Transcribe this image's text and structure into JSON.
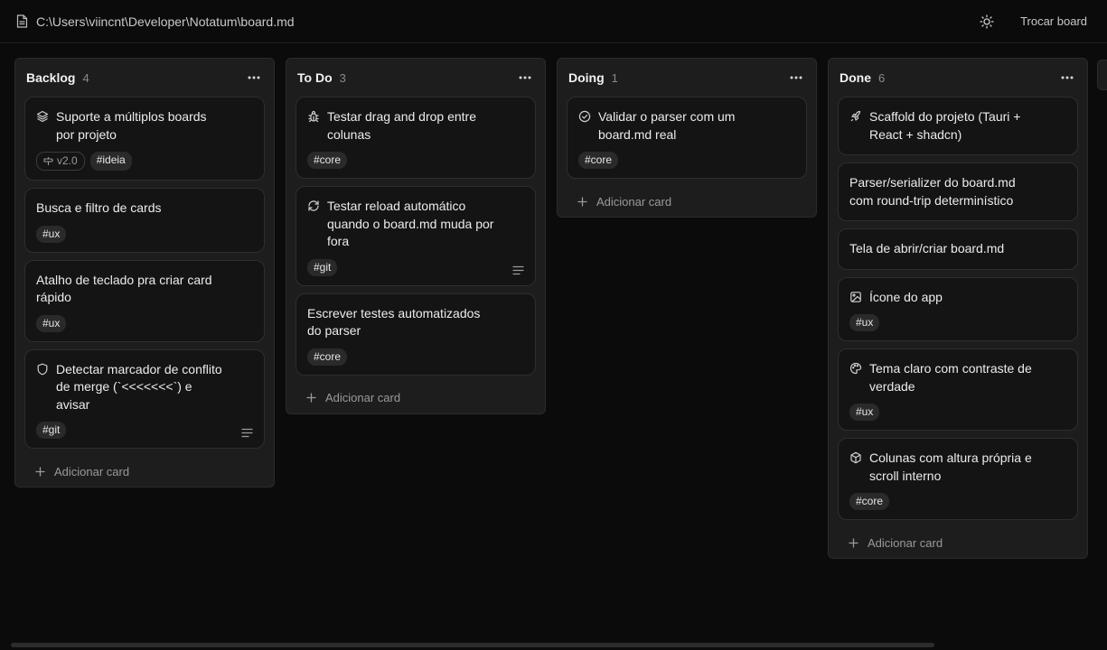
{
  "header": {
    "path": "C:\\Users\\viincnt\\Developer\\Notatum\\board.md",
    "switch_board_label": "Trocar board",
    "file_icon": "file-text-icon",
    "theme_icon": "sun-icon"
  },
  "board": {
    "add_card_label": "Adicionar card",
    "columns": [
      {
        "title": "Backlog",
        "count": "4",
        "cards": [
          {
            "title": "Suporte a múltiplos boards por projeto",
            "icon": "layers-icon",
            "version": "v2.0",
            "tags": [
              "#ideia"
            ],
            "has_description": false
          },
          {
            "title": "Busca e filtro de cards",
            "icon": "",
            "tags": [
              "#ux"
            ],
            "has_description": false
          },
          {
            "title": "Atalho de teclado pra criar card rápido",
            "icon": "",
            "tags": [
              "#ux"
            ],
            "has_description": false
          },
          {
            "title": "Detectar marcador de conflito de merge (`<<<<<<<`) e avisar",
            "icon": "shield-icon",
            "tags": [
              "#git"
            ],
            "has_description": true
          }
        ]
      },
      {
        "title": "To Do",
        "count": "3",
        "cards": [
          {
            "title": "Testar drag and drop entre colunas",
            "icon": "bug-icon",
            "tags": [
              "#core"
            ],
            "has_description": false
          },
          {
            "title": "Testar reload automático quando o board.md muda por fora",
            "icon": "refresh-icon",
            "tags": [
              "#git"
            ],
            "has_description": true
          },
          {
            "title": "Escrever testes automatizados do parser",
            "icon": "",
            "tags": [
              "#core"
            ],
            "has_description": false
          }
        ]
      },
      {
        "title": "Doing",
        "count": "1",
        "cards": [
          {
            "title": "Validar o parser com um board.md real",
            "icon": "check-circle-icon",
            "tags": [
              "#core"
            ],
            "has_description": false
          }
        ]
      },
      {
        "title": "Done",
        "count": "6",
        "cards": [
          {
            "title": "Scaffold do projeto (Tauri + React + shadcn)",
            "icon": "rocket-icon",
            "tags": [],
            "has_description": false
          },
          {
            "title": "Parser/serializer do board.md com round-trip determinístico",
            "icon": "",
            "tags": [],
            "has_description": false
          },
          {
            "title": "Tela de abrir/criar board.md",
            "icon": "",
            "tags": [],
            "has_description": false
          },
          {
            "title": "Ícone do app",
            "icon": "image-icon",
            "tags": [
              "#ux"
            ],
            "has_description": false
          },
          {
            "title": "Tema claro com contraste de verdade",
            "icon": "palette-icon",
            "tags": [
              "#ux"
            ],
            "has_description": false
          },
          {
            "title": "Colunas com altura própria e scroll interno",
            "icon": "box-icon",
            "tags": [
              "#core"
            ],
            "has_description": false
          }
        ]
      }
    ]
  },
  "colors": {
    "background": "#0b0b0b",
    "column": "#1d1d1d",
    "card": "#141414",
    "tag": "#2a2a2a"
  }
}
